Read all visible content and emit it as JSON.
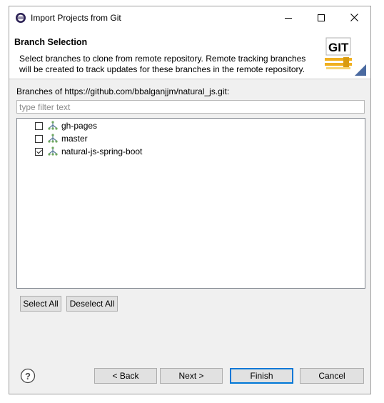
{
  "window": {
    "title": "Import Projects from Git",
    "controls": {
      "minimize": "minimize-icon",
      "maximize": "maximize-icon",
      "close": "close-icon"
    }
  },
  "header": {
    "title": "Branch Selection",
    "description_line1": "Select branches to clone from remote repository. Remote tracking branches",
    "description_line2": "will be created to track updates for these branches in the remote repository.",
    "logo_text": "GIT"
  },
  "branches": {
    "label": "Branches of https://github.com/bbalganjjm/natural_js.git:",
    "filter_placeholder": "type filter text",
    "items": [
      {
        "label": "gh-pages",
        "checked": false
      },
      {
        "label": "master",
        "checked": false
      },
      {
        "label": "natural-js-spring-boot",
        "checked": true
      }
    ]
  },
  "selection_buttons": {
    "select_all": "Select All",
    "deselect_all": "Deselect All"
  },
  "footer": {
    "help_icon": "help-icon",
    "back": "< Back",
    "next": "Next >",
    "finish": "Finish",
    "cancel": "Cancel"
  },
  "colors": {
    "accent": "#0078d7",
    "dialog_bg": "#f0f0f0",
    "git_green": "#2e8b2e"
  }
}
